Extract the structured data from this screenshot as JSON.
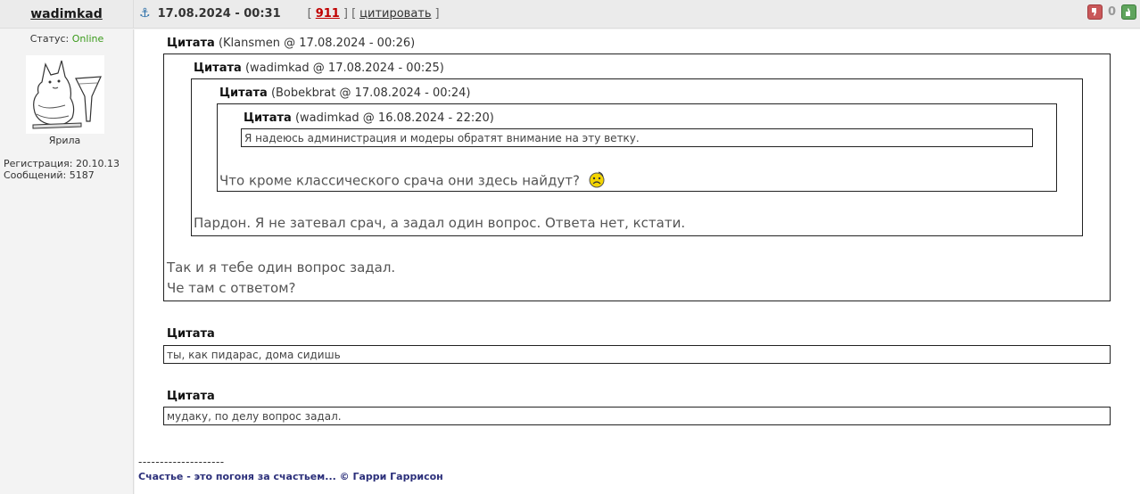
{
  "author": {
    "username": "wadimkad",
    "status_label": "Статус:",
    "status_value": "Online",
    "rank": "Ярила",
    "registration": "Регистрация: 20.10.13",
    "messages": "Сообщений: 5187"
  },
  "post": {
    "date": "17.08.2024 - 00:31",
    "bracket_open": "[",
    "number": "911",
    "bracket_mid": "] [",
    "quote_action": "цитировать",
    "bracket_close": "]",
    "rating_count": "0"
  },
  "quotes": {
    "q1_label": "Цитата",
    "q1_meta": "(Klansmen @ 17.08.2024 - 00:26)",
    "q2_label": "Цитата",
    "q2_meta": "(wadimkad @ 17.08.2024 - 00:25)",
    "q3_label": "Цитата",
    "q3_meta": "(Bobekbrat @ 17.08.2024 - 00:24)",
    "q4_label": "Цитата",
    "q4_meta": "(wadimkad @ 16.08.2024 - 22:20)",
    "q4_text": "Я надеюсь администрация и модеры обратят внимание на эту ветку.",
    "q3_text": "Что кроме классического срача они здесь найдут?",
    "q2_text": "Пардон. Я не затевал срач, а задал один вопрос. Ответа нет, кстати.",
    "q1_text_1": "Так и я тебе один вопрос задал.",
    "q1_text_2": "Че там с ответом?",
    "q5_label": "Цитата",
    "q5_text": "ты, как пидарас, дома сидишь",
    "q6_label": "Цитата",
    "q6_text": "мудаку, по делу вопрос задал."
  },
  "signature": {
    "separator": "--------------------",
    "text": "Счастье - это погоня за счастьем... © Гарри Гаррисон"
  },
  "colors": {
    "online": "#3a9a1a",
    "post_number": "#c00000",
    "signature": "#2b2f7a"
  }
}
